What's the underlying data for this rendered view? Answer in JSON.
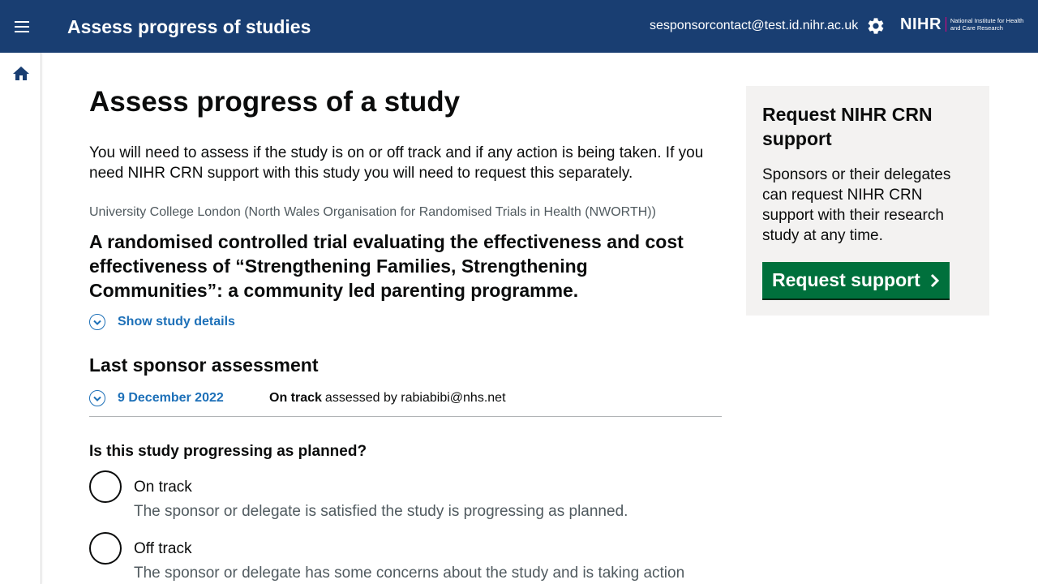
{
  "header": {
    "title": "Assess progress of studies",
    "user_email": "sesponsorcontact@test.id.nihr.ac.uk",
    "logo_mark": "NIHR",
    "logo_text": "National Institute for Health and Care Research"
  },
  "icons": {
    "menu": "menu-icon",
    "settings": "gear-icon",
    "home": "home-icon",
    "expand": "chevron-down-icon",
    "button_arrow": "chevron-right-icon"
  },
  "colors": {
    "header_bg": "#193e72",
    "link": "#1d70b8",
    "button_bg": "#00703c",
    "aside_bg": "#f3f2f1"
  },
  "main": {
    "page_title": "Assess progress of a study",
    "intro": "You will need to assess if the study is on or off track and if any action is being taken. If you need NIHR CRN support with this study you will need to request this separately.",
    "organisation": "University College London (North Wales Organisation for Randomised Trials in Health (NWORTH))",
    "study_title": "A randomised controlled trial evaluating the effectiveness and cost effectiveness of “Strengthening Families, Strengthening Communities”: a community led parenting programme.",
    "show_details_label": "Show study details",
    "last_assessment_heading": "Last sponsor assessment",
    "last_assessment": {
      "date": "9 December 2022",
      "status": "On track",
      "assessed_by": "assessed by rabiabibi@nhs.net"
    },
    "question": "Is this study progressing as planned?",
    "options": [
      {
        "label": "On track",
        "hint": "The sponsor or delegate is satisfied the study is progressing as planned."
      },
      {
        "label": "Off track",
        "hint": "The sponsor or delegate has some concerns about the study and is taking action where appropriate."
      }
    ]
  },
  "aside": {
    "title": "Request NIHR CRN support",
    "text": "Sponsors or their delegates can request NIHR CRN support with their research study at any time.",
    "button_label": "Request support"
  }
}
